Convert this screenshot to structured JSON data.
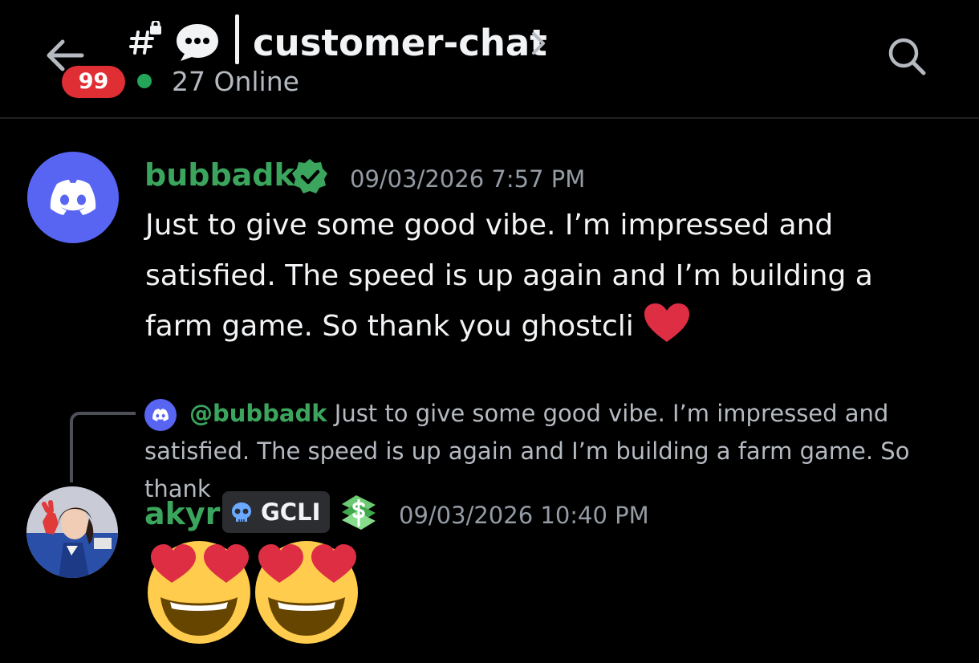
{
  "header": {
    "unread_count": "99",
    "online_text": "27 Online",
    "channel_name": "customer-chat"
  },
  "messages": [
    {
      "username": "bubbadk",
      "timestamp": "09/03/2026 7:57 PM",
      "text": "Just to give some good vibe. I’m impressed and satisfied. The speed is up again and I’m building a farm game. So thank you ghostcli"
    },
    {
      "reply_to": {
        "mention": "@bubbadk",
        "text": "Just to give some good vibe. I’m impressed and satisfied. The speed is up again and I’m building a farm game. So thank"
      },
      "username": "akyr",
      "tag": "GCLI",
      "timestamp": "09/03/2026 10:40 PM"
    }
  ],
  "colors": {
    "background": "#000000",
    "username_green": "#3ba55d",
    "blurple": "#5865f2",
    "badge_red": "#e02e35",
    "online_green": "#23a55a"
  },
  "icons": [
    "back-arrow-icon",
    "private-channel-icon",
    "chat-bubble-icon",
    "chevron-right-icon",
    "search-icon",
    "discord-logo-icon",
    "verified-badge-icon",
    "skull-icon",
    "money-icon",
    "red-heart-icon",
    "heart-eyes-emoji"
  ]
}
